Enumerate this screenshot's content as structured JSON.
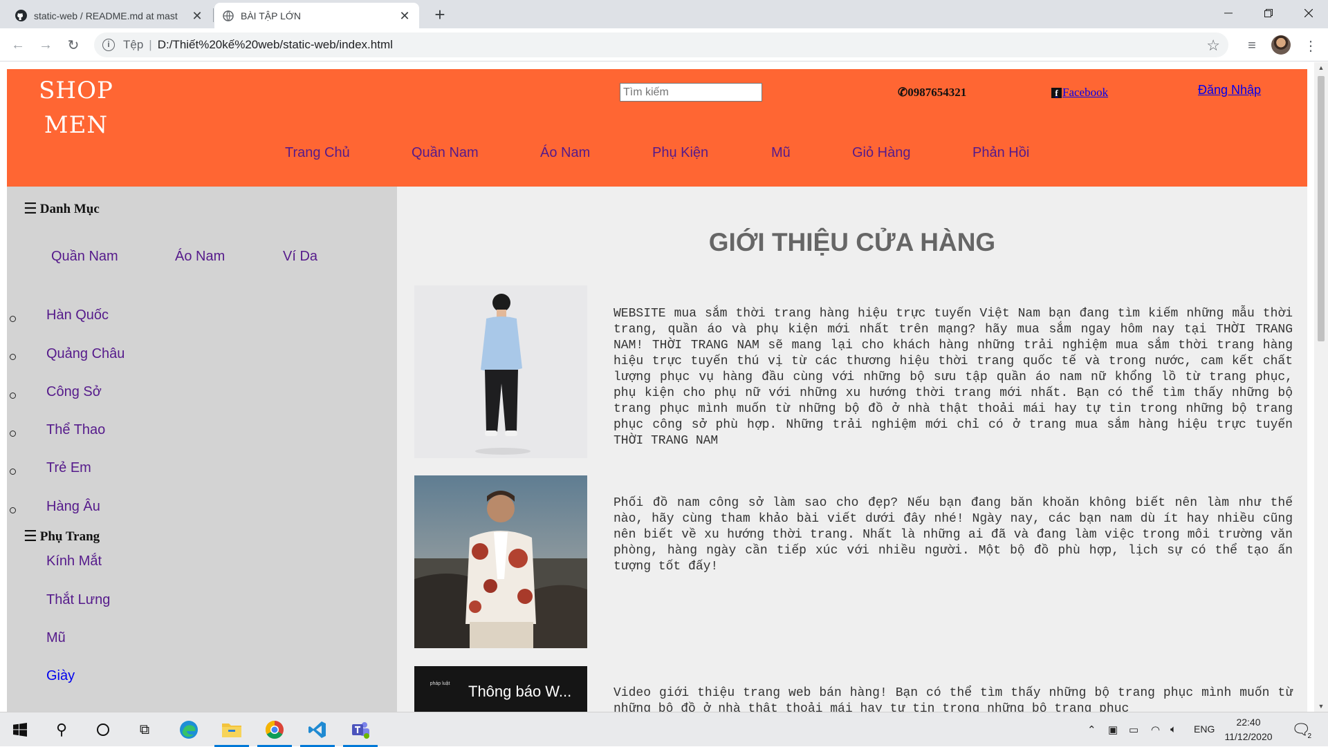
{
  "browser": {
    "tabs": [
      {
        "title": "static-web / README.md at mast",
        "active": false
      },
      {
        "title": "BÀI TẬP LỚN",
        "active": true
      }
    ],
    "address": {
      "scheme_label": "Tệp",
      "url": "D:/Thiết%20kế%20web/static-web/index.html"
    }
  },
  "site": {
    "logo_line1": "SHOP",
    "logo_line2": "MEN",
    "search_placeholder": "Tìm kiếm",
    "phone": "0987654321",
    "facebook": "Facebook",
    "login": "Đăng Nhập",
    "nav": [
      "Trang Chủ",
      "Quần Nam",
      "Áo Nam",
      "Phụ Kiện",
      "Mũ",
      "Giỏ Hàng",
      "Phản Hồi"
    ]
  },
  "sidebar": {
    "category_title": "Danh Mục",
    "category_tabs": [
      "Quần Nam",
      "Áo Nam",
      "Ví Da"
    ],
    "category_items": [
      "Hàn Quốc",
      "Quảng Châu",
      "Công Sở",
      "Thể Thao",
      "Trẻ Em",
      "Hàng Âu"
    ],
    "accessory_title": "Phụ Trang",
    "accessory_items": [
      "Kính Mắt",
      "Thắt Lưng",
      "Mũ",
      "Giày"
    ]
  },
  "main": {
    "title": "GIỚI THIỆU CỬA HÀNG",
    "articles": [
      {
        "text": "WEBSITE mua sắm thời trang hàng hiệu trực tuyến Việt Nam bạn đang tìm kiếm những mẫu thời trang, quần áo và phụ kiện mới nhất trên mạng? hãy mua sắm ngay hôm nay tại THỜI TRANG NAM! THỜI TRANG NAM sẽ mang lại cho khách hàng những trải nghiệm mua sắm thời trang hàng hiệu trực tuyến thú vị từ các thương hiệu thời trang quốc tế và trong nước, cam kết chất lượng phục vụ hàng đầu cùng với những bộ sưu tập quần áo nam nữ khổng lồ từ trang phục, phụ kiện cho phụ nữ với những xu hướng thời trang mới nhất. Bạn có thể tìm thấy những bộ trang phục mình muốn từ những bộ đồ ở nhà thật thoải mái hay tự tin trong những bộ trang phục công sở phù hợp. Những trải nghiệm mới chỉ có ở trang mua sắm hàng hiệu trực tuyến THỜI TRANG NAM"
      },
      {
        "text": "Phối đồ nam công sở làm sao cho đẹp? Nếu bạn đang băn khoăn không biết nên làm như thế nào, hãy cùng tham khảo bài viết dưới đây nhé! Ngày nay, các bạn nam dù ít hay nhiều cũng nên biết về xu hướng thời trang. Nhất là những ai đã và đang làm việc trong môi trường văn phòng, hàng ngày cần tiếp xúc với nhiều người. Một bộ đồ phù hợp, lịch sự có thể tạo ấn tượng tốt đấy!"
      },
      {
        "text": "Video giới thiệu trang web bán hàng! Bạn có thể tìm thấy những bộ trang phục mình muốn từ những bộ đồ ở nhà thật thoải mái hay tự tin trong những bộ trang phục"
      }
    ],
    "video_title": "Thông báo W...",
    "video_channel": "pháp luật"
  },
  "taskbar": {
    "language": "ENG",
    "time": "22:40",
    "date": "11/12/2020",
    "notifications": "2"
  },
  "colors": {
    "header": "#ff6633",
    "sidebar": "#d3d3d3",
    "content": "#efefef",
    "visited_link": "#551a8b",
    "link": "#0000ee"
  }
}
